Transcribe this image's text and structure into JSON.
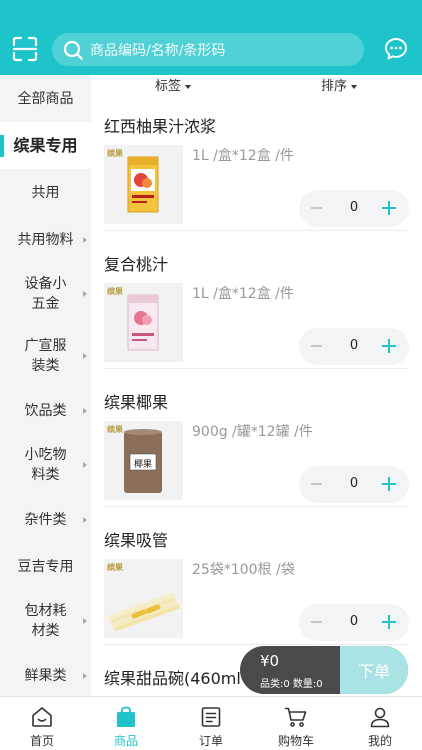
{
  "colors": {
    "accent": "#1fc4cb",
    "sidebar_bg": "#f3f4f6",
    "cart_bar": "#4a4a4a",
    "order_button": "#a9e3e6"
  },
  "header": {
    "search_placeholder": "商品编码/名称/条形码",
    "scan_icon": "scan-icon",
    "message_icon": "message-icon"
  },
  "sidebar": {
    "items": [
      {
        "label": "全部商品",
        "active": false,
        "has_arrow": false
      },
      {
        "label": "缤果专用",
        "active": true,
        "has_arrow": false
      },
      {
        "label": "共用",
        "active": false,
        "has_arrow": false
      },
      {
        "label": "共用物料",
        "active": false,
        "has_arrow": true
      },
      {
        "label": "设备小五金",
        "active": false,
        "has_arrow": true
      },
      {
        "label": "广宣服装类",
        "active": false,
        "has_arrow": true
      },
      {
        "label": "饮品类",
        "active": false,
        "has_arrow": true
      },
      {
        "label": "小吃物料类",
        "active": false,
        "has_arrow": true
      },
      {
        "label": "杂件类",
        "active": false,
        "has_arrow": true
      },
      {
        "label": "豆吉专用",
        "active": false,
        "has_arrow": false
      },
      {
        "label": "包材耗材类",
        "active": false,
        "has_arrow": true
      },
      {
        "label": "鲜果类",
        "active": false,
        "has_arrow": true
      }
    ]
  },
  "filter": {
    "tag_label": "标签",
    "sort_label": "排序"
  },
  "products": [
    {
      "name": "红西柚果汁浓浆",
      "spec": "1L /盒*12盒 /件",
      "qty": "0",
      "image": "juice-carton-orange"
    },
    {
      "name": "复合桃汁",
      "spec": "1L /盒*12盒 /件",
      "qty": "0",
      "image": "juice-carton-peach"
    },
    {
      "name": "缤果椰果",
      "spec": "900g /罐*12罐 /件",
      "qty": "0",
      "image": "coconut-can"
    },
    {
      "name": "缤果吸管",
      "spec": "25袋*100根 /袋",
      "qty": "0",
      "image": "straws"
    },
    {
      "name": "缤果甜品碗(460ml",
      "spec": "",
      "qty": "",
      "image": ""
    }
  ],
  "product_image_texts": {
    "brand": "缤果",
    "can_label": "椰果"
  },
  "cart": {
    "total": "¥0",
    "counts": "品类:0 数量:0",
    "order_label": "下单"
  },
  "tabbar": {
    "items": [
      {
        "label": "首页",
        "icon": "home-icon",
        "active": false
      },
      {
        "label": "商品",
        "icon": "bag-icon",
        "active": true
      },
      {
        "label": "订单",
        "icon": "order-list-icon",
        "active": false
      },
      {
        "label": "购物车",
        "icon": "cart-icon",
        "active": false
      },
      {
        "label": "我的",
        "icon": "profile-icon",
        "active": false
      }
    ]
  }
}
